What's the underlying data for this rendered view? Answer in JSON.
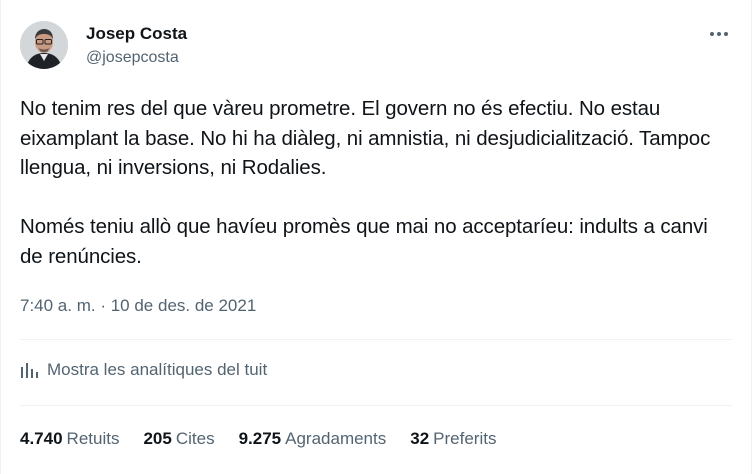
{
  "author": {
    "name": "Josep Costa",
    "handle": "@josepcosta"
  },
  "tweet": {
    "paragraph1": "No tenim res del que vàreu prometre. El govern no és efectiu. No estau eixamplant la base. No hi ha diàleg, ni amnistia, ni desjudicialització. Tampoc llengua, ni inversions, ni Rodalies.",
    "paragraph2": "Només teniu allò que havíeu promès que mai no acceptaríeu: indults a canvi de renúncies.",
    "time": "7:40 a. m.",
    "separator": " · ",
    "date": "10 de des. de 2021"
  },
  "analytics": {
    "label": "Mostra les analítiques del tuit",
    "icon": "analytics-icon"
  },
  "stats": [
    {
      "value": "4.740",
      "label": "Retuits"
    },
    {
      "value": "205",
      "label": "Cites"
    },
    {
      "value": "9.275",
      "label": "Agradaments"
    },
    {
      "value": "32",
      "label": "Preferits"
    }
  ],
  "colors": {
    "text": "#0f1419",
    "secondary": "#536471",
    "border": "#eff3f4"
  }
}
